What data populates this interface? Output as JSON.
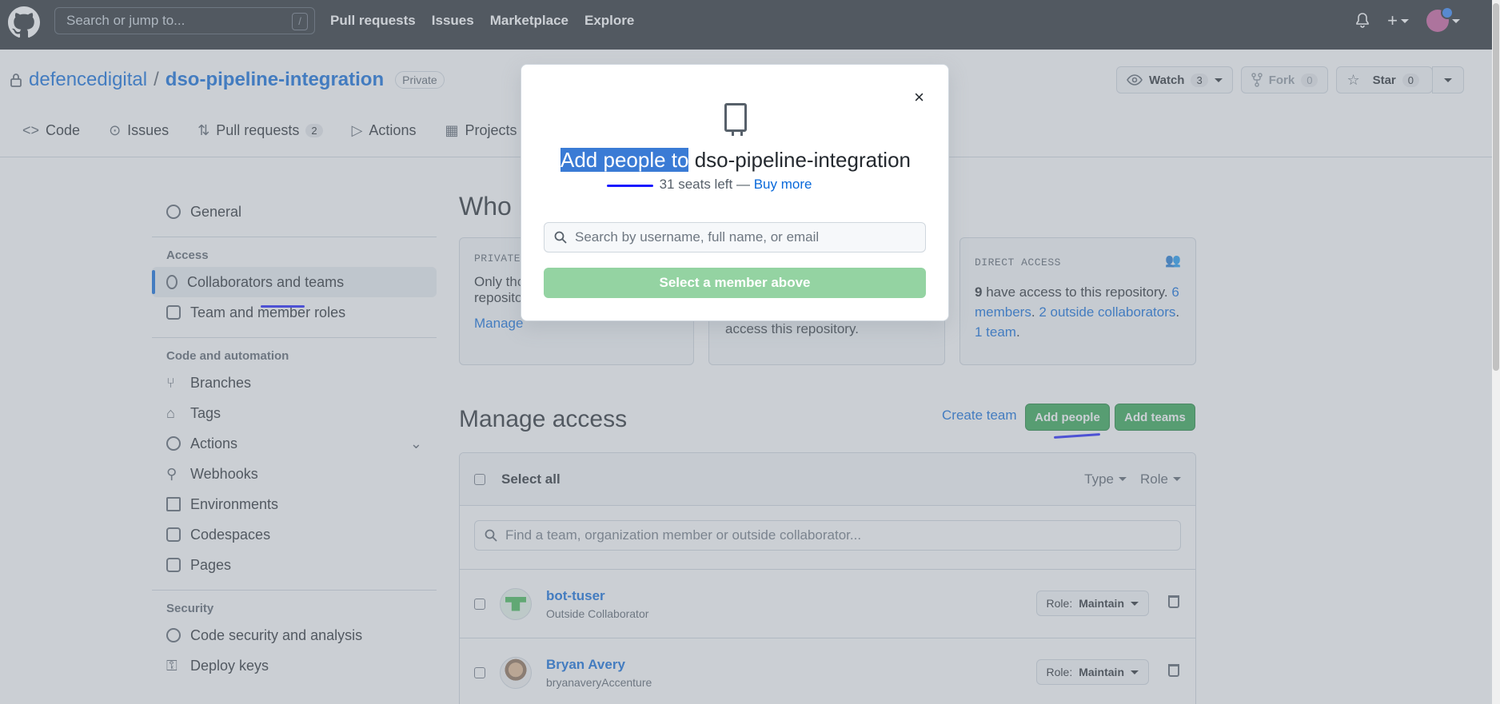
{
  "header": {
    "search_placeholder": "Search or jump to...",
    "search_shortcut": "/",
    "nav": [
      "Pull requests",
      "Issues",
      "Marketplace",
      "Explore"
    ]
  },
  "repo": {
    "owner": "defencedigital",
    "separator": "/",
    "name": "dso-pipeline-integration",
    "visibility": "Private",
    "watch_label": "Watch",
    "watch_count": "3",
    "fork_label": "Fork",
    "fork_count": "0",
    "star_label": "Star",
    "star_count": "0"
  },
  "tabs": [
    {
      "label": "Code",
      "count": ""
    },
    {
      "label": "Issues",
      "count": ""
    },
    {
      "label": "Pull requests",
      "count": "2"
    },
    {
      "label": "Actions",
      "count": ""
    },
    {
      "label": "Projects",
      "count": ""
    }
  ],
  "sidebar": {
    "general": "General",
    "access_heading": "Access",
    "collaborators": "Collaborators and teams",
    "team_roles": "Team and member roles",
    "code_heading": "Code and automation",
    "branches": "Branches",
    "tags": "Tags",
    "actions": "Actions",
    "webhooks": "Webhooks",
    "environments": "Environments",
    "codespaces": "Codespaces",
    "pages": "Pages",
    "security_heading": "Security",
    "code_security": "Code security and analysis",
    "deploy_keys": "Deploy keys"
  },
  "main": {
    "who_title": "Who h",
    "private_label": "PRIVATE",
    "private_text_1": "Only tho",
    "private_text_2": "reposito",
    "manage_link": "Manage",
    "middle_text": "access this repository.",
    "direct_label": "DIRECT ACCESS",
    "direct_count": "9",
    "direct_text": "have access to this repository.",
    "members_link_1": "6",
    "members_link_2": "members",
    "outside_link": "2 outside collaborators",
    "team_link": "1 team",
    "manage_access_title": "Manage access",
    "create_team": "Create team",
    "add_people": "Add people",
    "add_teams": "Add teams",
    "select_all": "Select all",
    "type_filter": "Type",
    "role_filter": "Role",
    "filter_placeholder": "Find a team, organization member or outside collaborator...",
    "rows": [
      {
        "name": "bot-tuser",
        "subtitle": "Outside Collaborator",
        "role_prefix": "Role:",
        "role": "Maintain"
      },
      {
        "name": "Bryan Avery",
        "subtitle": "bryanaveryAccenture",
        "role_prefix": "Role:",
        "role": "Maintain"
      }
    ]
  },
  "modal": {
    "title_highlight": "Add people to",
    "title_rest": "dso-pipeline-integration",
    "seats_text": "31 seats left —",
    "buy_more": "Buy more",
    "search_placeholder": "Search by username, full name, or email",
    "select_button": "Select a member above",
    "close": "×"
  },
  "colors": {
    "header_bg": "#24292f",
    "link": "#0969da",
    "green": "#2da44e",
    "green_disabled": "#94d3a2",
    "highlight": "#3a7bd5",
    "annotation": "#1a1aff"
  }
}
